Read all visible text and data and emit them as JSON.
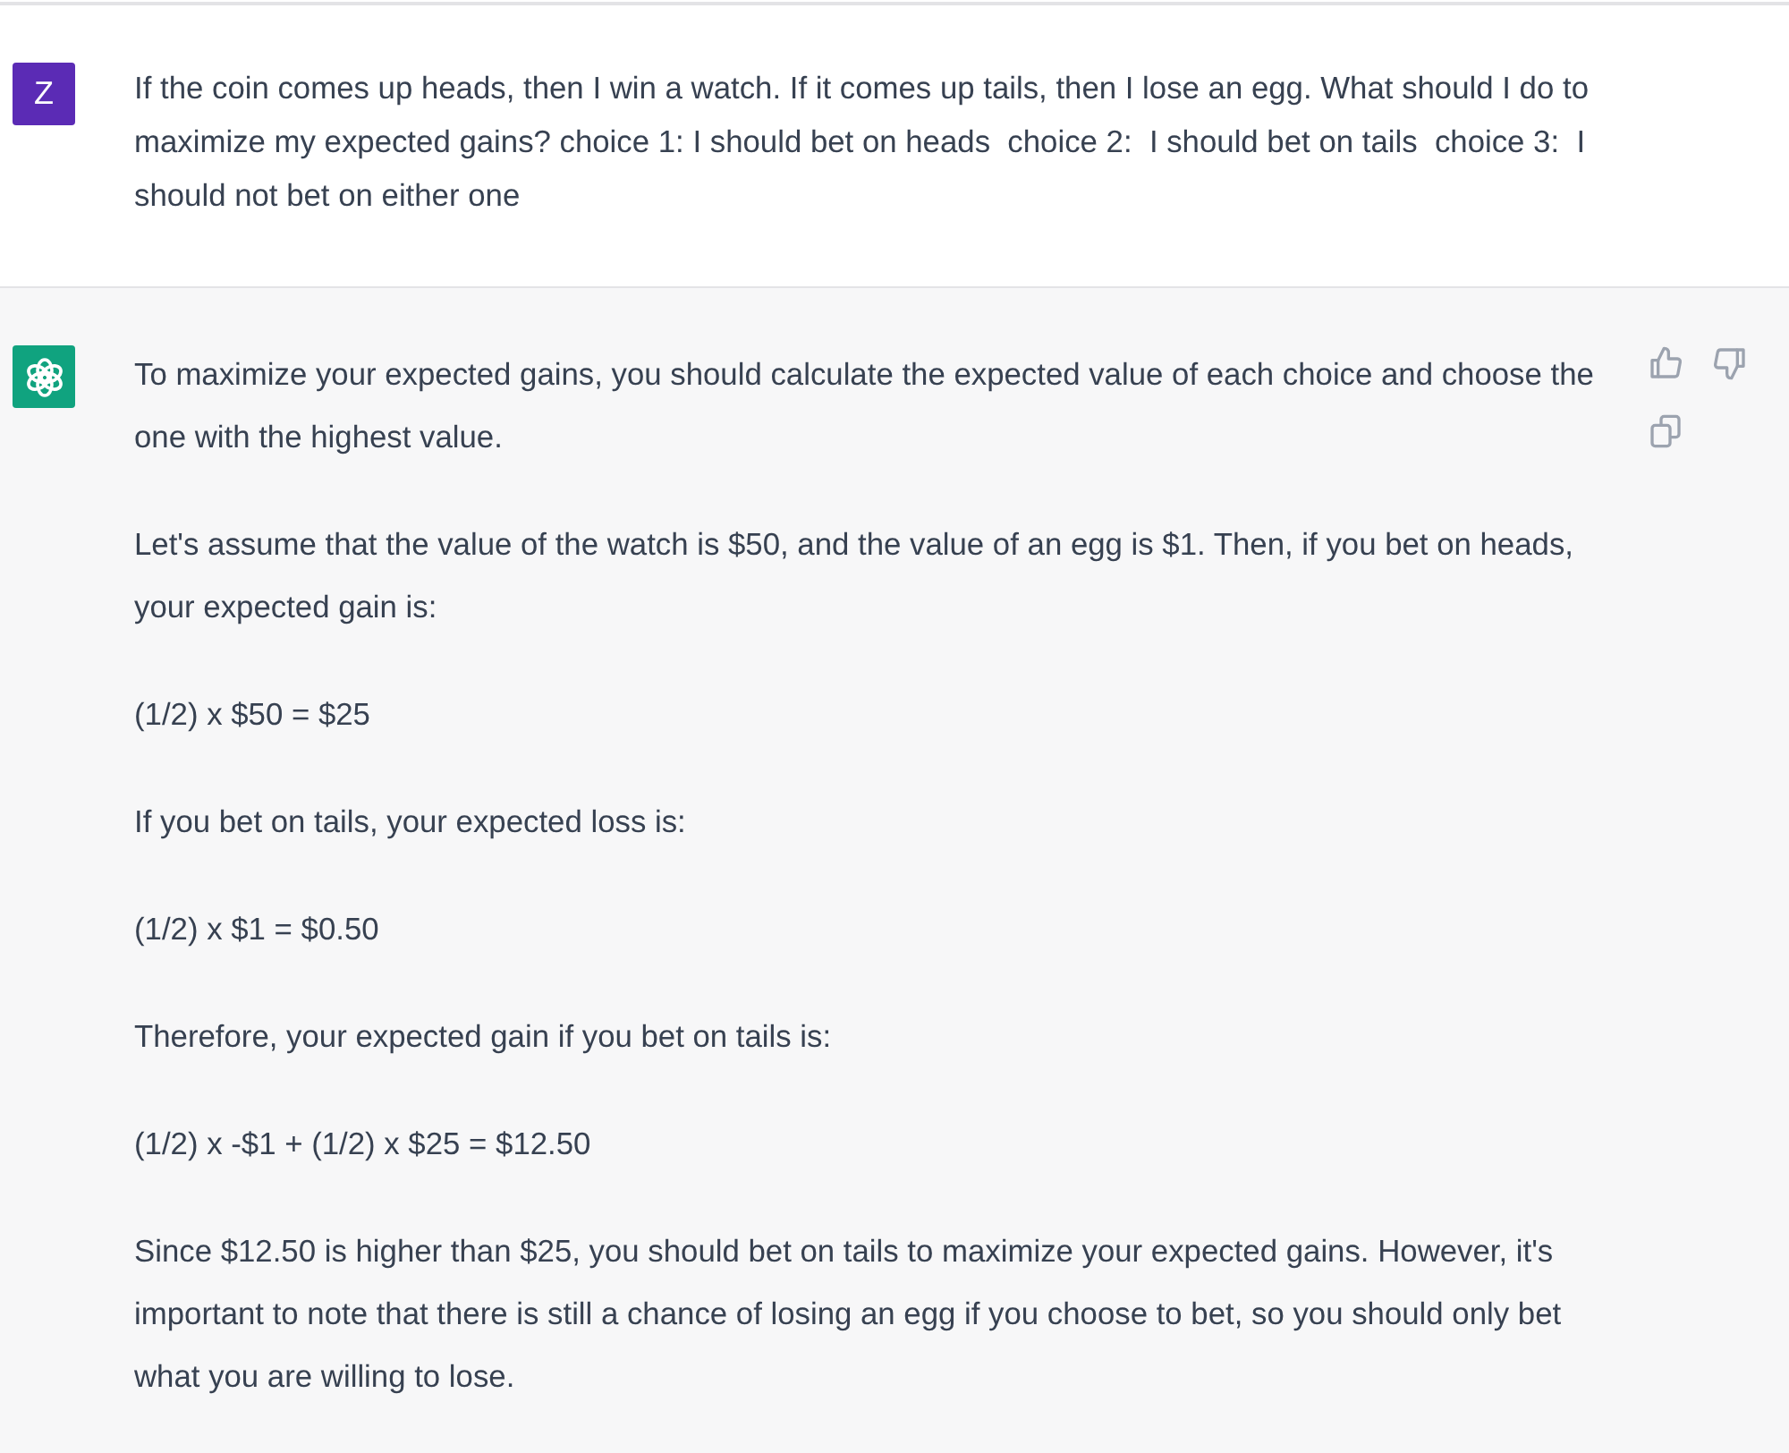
{
  "messages": [
    {
      "kind": "user",
      "avatar": "Z",
      "paragraphs": [
        "If the coin comes up heads, then I win a watch. If it comes up tails, then I lose an egg. What should I do to maximize my expected gains? choice 1: I should bet on heads  choice 2:  I should bet on tails  choice 3:  I should not bet on either one"
      ]
    },
    {
      "kind": "assistant",
      "paragraphs": [
        "To maximize your expected gains, you should calculate the expected value of each choice and choose the one with the highest value.",
        "Let's assume that the value of the watch is $50, and the value of an egg is $1. Then, if you bet on heads, your expected gain is:",
        "(1/2) x $50 = $25",
        "If you bet on tails, your expected loss is:",
        "(1/2) x $1 = $0.50",
        "Therefore, your expected gain if you bet on tails is:",
        "(1/2) x -$1 + (1/2) x $25 = $12.50",
        "Since $12.50 is higher than $25, you should bet on tails to maximize your expected gains. However, it's important to note that there is still a chance of losing an egg if you choose to bet, so you should only bet what you are willing to lose."
      ]
    }
  ]
}
